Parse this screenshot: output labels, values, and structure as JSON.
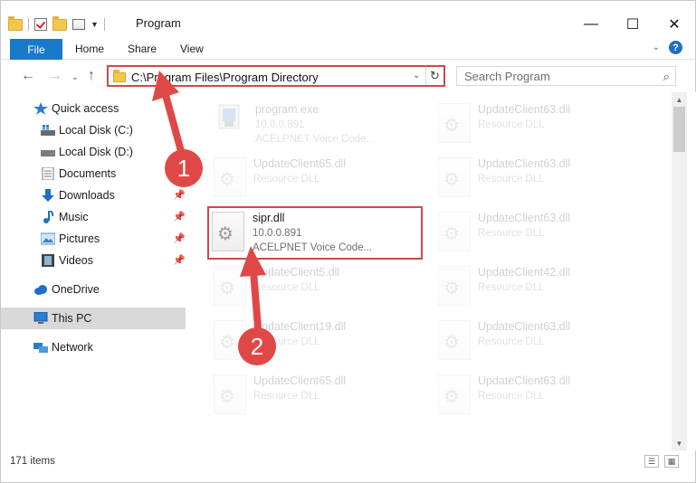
{
  "window": {
    "title": "Program"
  },
  "ribbon": {
    "tabs": [
      "File",
      "Home",
      "Share",
      "View"
    ]
  },
  "address": {
    "path": "C:\\Program Files\\Program Directory"
  },
  "search": {
    "placeholder": "Search Program"
  },
  "nav_pane": {
    "quick_access": "Quick access",
    "items": [
      {
        "label": "Local Disk (C:)",
        "pinned": false
      },
      {
        "label": "Local Disk (D:)",
        "pinned": false
      },
      {
        "label": "Documents",
        "pinned": false
      },
      {
        "label": "Downloads",
        "pinned": true
      },
      {
        "label": "Music",
        "pinned": true
      },
      {
        "label": "Pictures",
        "pinned": true
      },
      {
        "label": "Videos",
        "pinned": true
      }
    ],
    "onedrive": "OneDrive",
    "this_pc": "This PC",
    "network": "Network"
  },
  "files": [
    {
      "name": "program.exe",
      "line2": "10.0.0.891",
      "line3": "ACELPNET Voice Code...",
      "faded": true
    },
    {
      "name": "UpdateClient63.dll",
      "line2": "Resource DLL",
      "faded": true
    },
    {
      "name": "UpdateClient65.dll",
      "line2": "Resource DLL",
      "faded": true
    },
    {
      "name": "UpdateClient63.dll",
      "line2": "Resource DLL",
      "faded": true
    },
    {
      "name": "sipr.dll",
      "line2": "10.0.0.891",
      "line3": "ACELPNET Voice Code...",
      "faded": false,
      "highlighted": true
    },
    {
      "name": "UpdateClient63.dll",
      "line2": "Resource DLL",
      "faded": true
    },
    {
      "name": "UpdateClient5.dll",
      "line2": "Resource DLL",
      "faded": true
    },
    {
      "name": "UpdateClient42.dll",
      "line2": "Resource DLL",
      "faded": true
    },
    {
      "name": "UpdateClient19.dll",
      "line2": "Resource DLL",
      "faded": true
    },
    {
      "name": "UpdateClient63.dll",
      "line2": "Resource DLL",
      "faded": true
    },
    {
      "name": "UpdateClient65.dll",
      "line2": "Resource DLL",
      "faded": true
    },
    {
      "name": "UpdateClient63.dll",
      "line2": "Resource DLL",
      "faded": true
    }
  ],
  "status": {
    "item_count": "171 items"
  },
  "annotations": {
    "step1": "1",
    "step2": "2",
    "color": "#e04848"
  }
}
